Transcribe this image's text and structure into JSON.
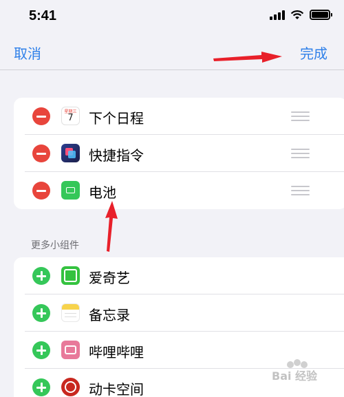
{
  "status": {
    "time": "5:41"
  },
  "nav": {
    "cancel": "取消",
    "done": "完成"
  },
  "active_widgets": [
    {
      "label": "下个日程",
      "icon": "calendar-icon",
      "cal_day": "星期三",
      "cal_num": "7"
    },
    {
      "label": "快捷指令",
      "icon": "shortcuts-icon"
    },
    {
      "label": "电池",
      "icon": "battery-icon"
    }
  ],
  "section_title": "更多小组件",
  "more_widgets": [
    {
      "label": "爱奇艺",
      "icon": "iqiyi-icon"
    },
    {
      "label": "备忘录",
      "icon": "notes-icon"
    },
    {
      "label": "哔哩哔哩",
      "icon": "bilibili-icon"
    },
    {
      "label": "动卡空间",
      "icon": "card-space-icon"
    }
  ],
  "watermark": "Bai 经验",
  "colors": {
    "accent": "#2f80e9",
    "remove": "#e8453c",
    "add": "#35c759",
    "annotation": "#e8202a"
  }
}
